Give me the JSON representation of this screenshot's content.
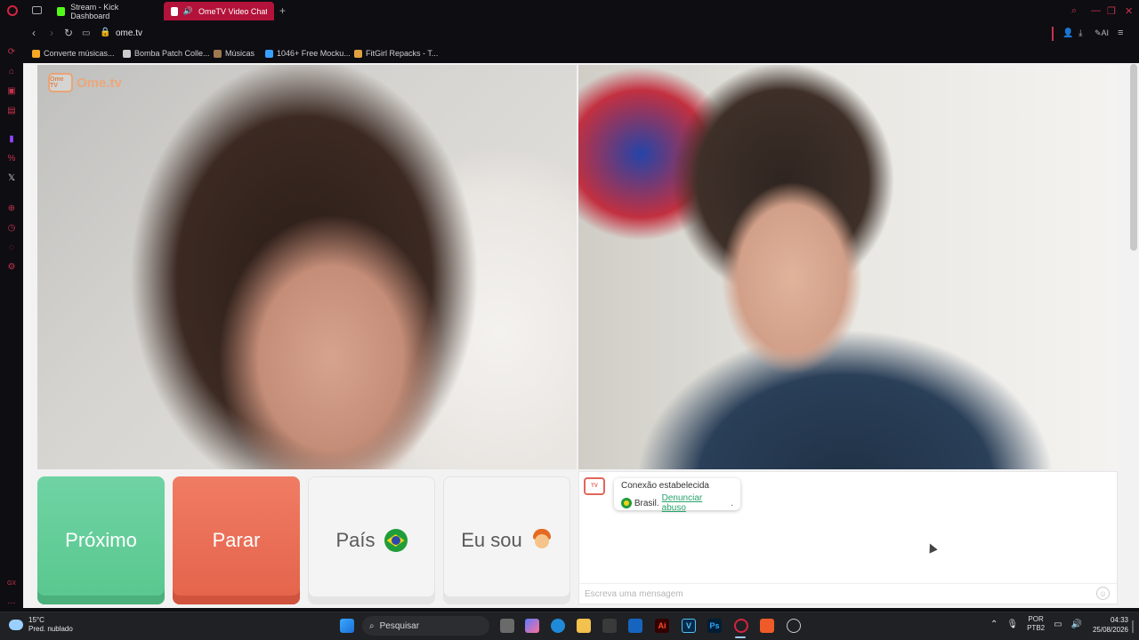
{
  "browser": {
    "tabs": [
      {
        "label": "Stream - Kick Dashboard",
        "active": false,
        "color": "#53fc18"
      },
      {
        "label": "OmeTV Video Chat — C",
        "active": true,
        "color": "#ffffff"
      }
    ],
    "url": "ome.tv",
    "bookmarks": [
      {
        "label": "Converte músicas...",
        "color": "#f5a623"
      },
      {
        "label": "Bomba Patch Colle...",
        "color": "#cccccc"
      },
      {
        "label": "Músicas",
        "color": "#a0784e"
      },
      {
        "label": "1046+ Free Mocku...",
        "color": "#3aa0ff"
      },
      {
        "label": "FitGirl Repacks - T...",
        "color": "#e0a040"
      }
    ],
    "ai_label": "AI"
  },
  "sidebar_icons": [
    "opera-logo-icon",
    "recent-icon",
    "bag-icon",
    "messenger-icon",
    "news-icon",
    "twitch-icon",
    "percent-icon",
    "x-icon",
    "add-icon",
    "history-icon",
    "chat-icon",
    "settings-icon",
    "gx-icon",
    "more-icon"
  ],
  "ometv": {
    "logo_name": "Ome.tv",
    "logo_badge": "Ome TV",
    "buttons": {
      "next": "Próximo",
      "stop": "Parar",
      "country": "País",
      "iam": "Eu sou"
    },
    "colors": {
      "next": "#62cd97",
      "stop": "#eb6f56",
      "brand": "#f3a36f"
    }
  },
  "chat": {
    "connected": "Conexão estabelecida",
    "country": "Brasil.",
    "report": "Denunciar abuso",
    "report_suffix": ".",
    "placeholder": "Escreva uma mensagem"
  },
  "taskbar": {
    "weather_temp": "15°C",
    "weather_desc": "Pred. nublado",
    "search_placeholder": "Pesquisar",
    "lang_top": "POR",
    "lang_bottom": "PTB2",
    "time": "04:33",
    "date": "25/08/2026"
  }
}
